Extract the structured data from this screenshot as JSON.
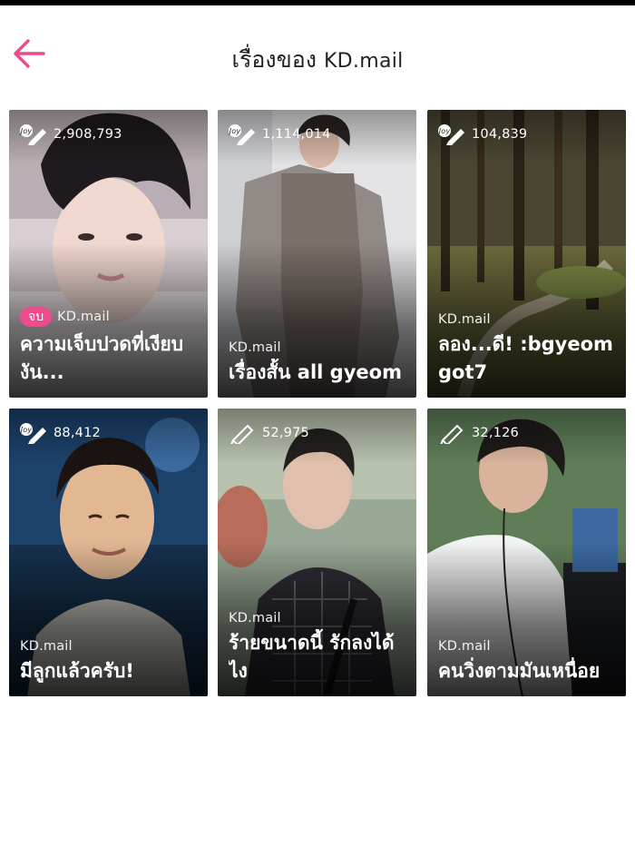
{
  "header": {
    "title": "เรื่องของ",
    "author": "KD.mail",
    "accent_color": "#ec4b8c"
  },
  "stories": [
    {
      "views": "2,908,793",
      "icon": "jobtrades-pen-icon",
      "badge": "จบ",
      "author": "KD.mail",
      "title": "ความเจ็บปวดที่เงียบงัน..."
    },
    {
      "views": "1,114,014",
      "icon": "jobtrades-pen-icon",
      "author": "KD.mail",
      "title": "เรื่องสั้น all gyeom"
    },
    {
      "views": "104,839",
      "icon": "jobtrades-pen-icon",
      "author": "KD.mail",
      "title": "ลอง...ดี! :bgyeom got7"
    },
    {
      "views": "88,412",
      "icon": "jobtrades-pen-icon",
      "author": "KD.mail",
      "title": "มีลูกแล้วครับ!"
    },
    {
      "views": "52,975",
      "icon": "pen-icon",
      "author": "KD.mail",
      "title": "ร้ายขนาดนี้ รักลงได้ไง"
    },
    {
      "views": "32,126",
      "icon": "pen-icon",
      "author": "KD.mail",
      "title": "คนวิ่งตามมันเหนื่อย"
    }
  ]
}
